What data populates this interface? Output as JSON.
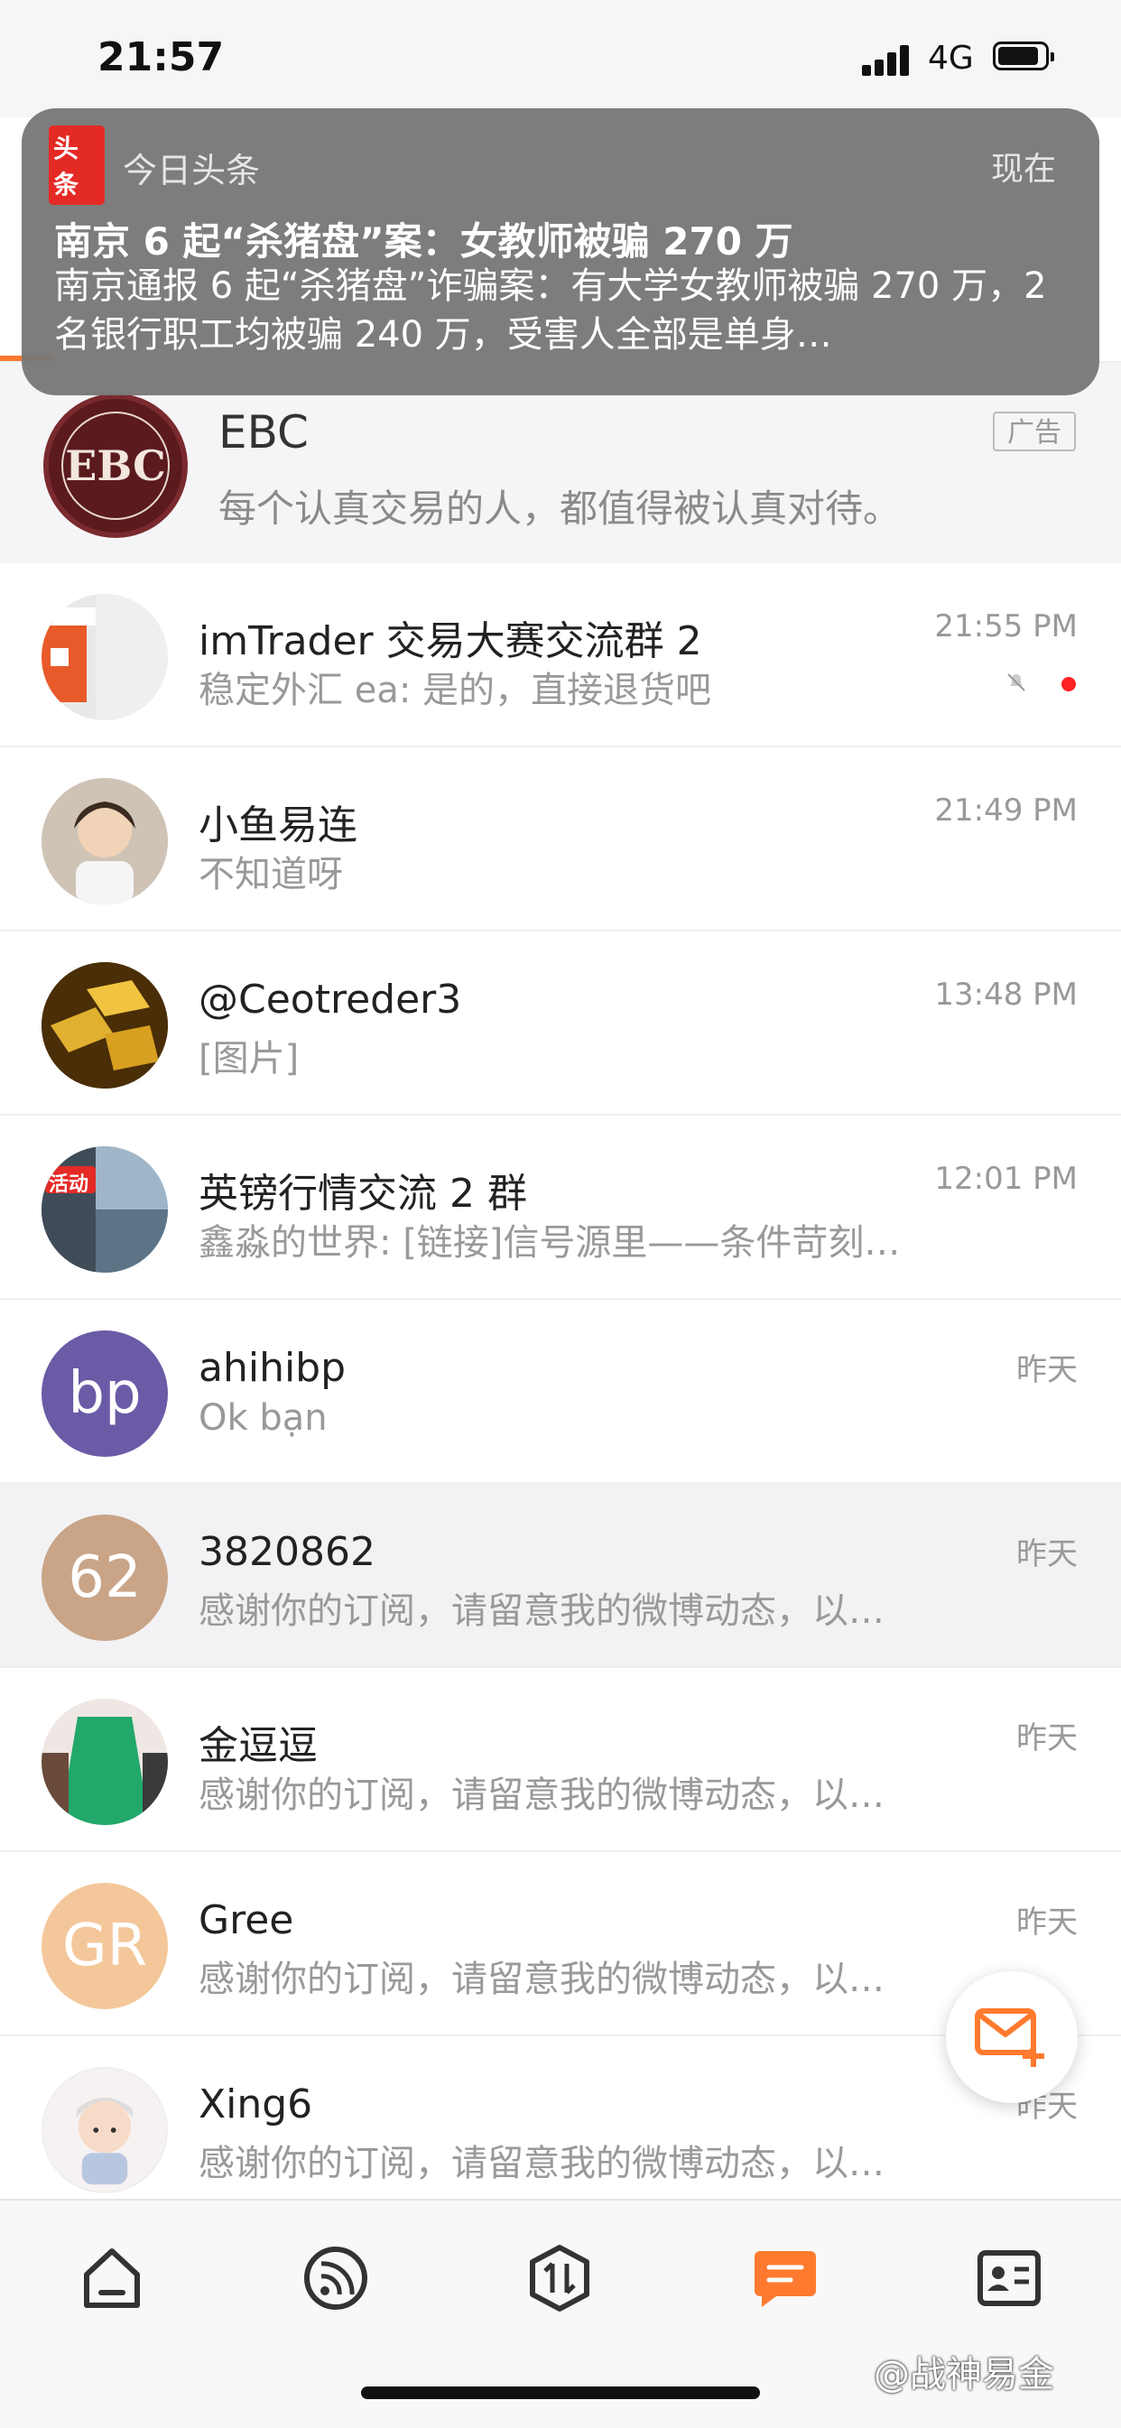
{
  "status_bar": {
    "time": "21:57",
    "network": "4G"
  },
  "notification": {
    "app_name": "今日头条",
    "app_icon_text": "头条",
    "time": "现在",
    "title": "南京 6 起“杀猪盘”案：女教师被骗 270 万",
    "body": "南京通报 6 起“杀猪盘”诈骗案：有大学女教师被骗 270 万，2 名银行职工均被骗 240 万，受害人全部是单身…"
  },
  "ad": {
    "name": "EBC",
    "subtitle": "每个认真交易的人，都值得被认真对待。",
    "badge": "广告",
    "logo_text": "EBC"
  },
  "chats": [
    {
      "name": "imTrader 交易大赛交流群 2",
      "preview": "稳定外汇 ea: 是的，直接退货吧",
      "time": "21:55 PM",
      "muted": true,
      "unread": true,
      "avatar_color": "#e85a2a"
    },
    {
      "name": "小鱼易连",
      "preview": "不知道呀",
      "time": "21:49 PM",
      "avatar_color": "#c9b8a8"
    },
    {
      "name": "@Ceotreder3",
      "preview": "[图片]",
      "time": "13:48 PM",
      "avatar_color": "#b8860b"
    },
    {
      "name": "英镑行情交流 2 群",
      "preview": "鑫淼的世界: [链接]信号源里——条件苛刻…",
      "time": "12:01 PM",
      "avatar_badge": "活动",
      "avatar_color": "#6a8aa8"
    },
    {
      "name": "ahihibp",
      "preview": "Ok bạn",
      "time": "昨天",
      "avatar_text": "bp",
      "avatar_color": "#6b5aa6"
    },
    {
      "name": "3820862",
      "preview": "感谢你的订阅，请留意我的微博动态，以…",
      "time": "昨天",
      "avatar_text": "62",
      "avatar_color": "#c9a487"
    },
    {
      "name": "金逗逗",
      "preview": "感谢你的订阅，请留意我的微博动态，以…",
      "time": "昨天",
      "avatar_color": "#2aa06a"
    },
    {
      "name": "Gree",
      "preview": "感谢你的订阅，请留意我的微博动态，以…",
      "time": "昨天",
      "avatar_text": "GR",
      "avatar_color": "#f4c79a"
    },
    {
      "name": "Xing6",
      "preview": "感谢你的订阅，请留意我的微博动态，以…",
      "time": "昨天",
      "avatar_color": "#f3ecec"
    }
  ],
  "tabs": [
    {
      "name": "home-icon",
      "active": false
    },
    {
      "name": "feed-icon",
      "active": false
    },
    {
      "name": "trade-icon",
      "active": false
    },
    {
      "name": "messages-icon",
      "active": true
    },
    {
      "name": "profile-card-icon",
      "active": false
    }
  ],
  "colors": {
    "accent": "#ff7a2e",
    "notification_bg": "#787878",
    "unread": "#ff2222"
  },
  "watermark": "@战神易金"
}
